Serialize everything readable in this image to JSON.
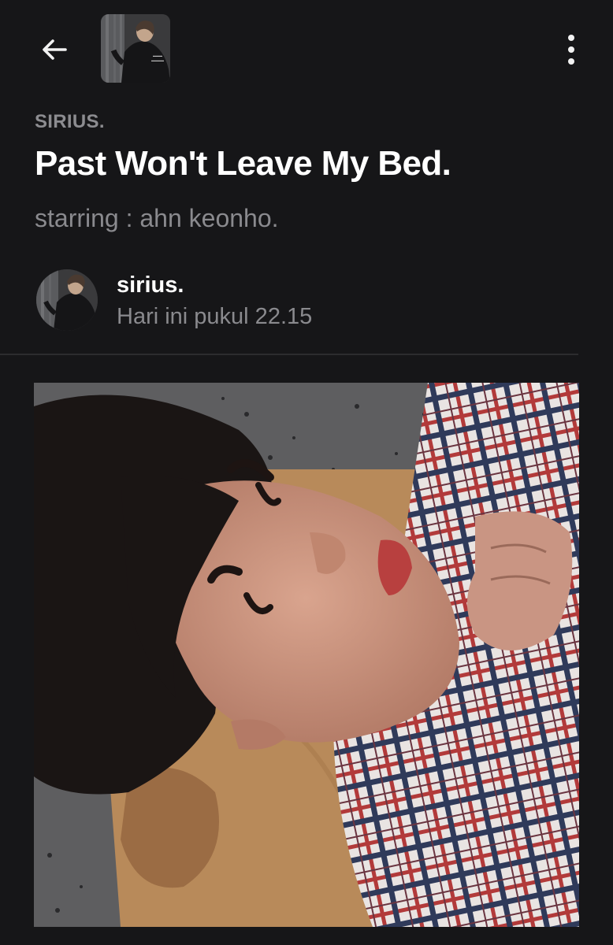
{
  "header": {
    "back_icon": "arrow-left-icon",
    "more_icon": "more-vertical-icon"
  },
  "story": {
    "kicker": "SIRIUS.",
    "title": "Past Won't Leave My Bed.",
    "subtitle": "starring : ahn keonho."
  },
  "author": {
    "name": "sirius.",
    "time": "Hari ini pukul 22.15"
  },
  "colors": {
    "background": "#161618",
    "text_primary": "#ffffff",
    "text_secondary": "#8a8a8e"
  }
}
